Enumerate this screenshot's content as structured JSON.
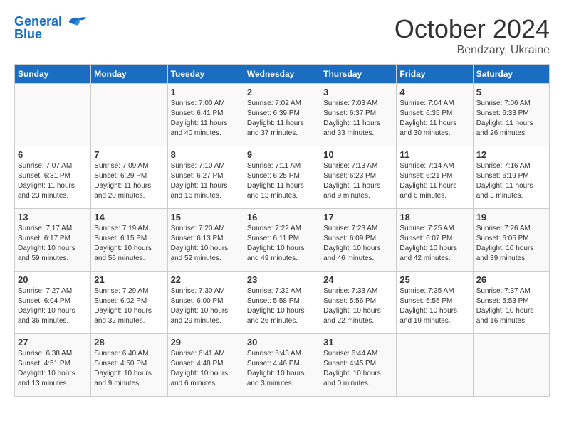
{
  "header": {
    "logo_line1": "General",
    "logo_line2": "Blue",
    "month": "October 2024",
    "location": "Bendzary, Ukraine"
  },
  "weekdays": [
    "Sunday",
    "Monday",
    "Tuesday",
    "Wednesday",
    "Thursday",
    "Friday",
    "Saturday"
  ],
  "weeks": [
    [
      {
        "day": "",
        "info": ""
      },
      {
        "day": "",
        "info": ""
      },
      {
        "day": "1",
        "info": "Sunrise: 7:00 AM\nSunset: 6:41 PM\nDaylight: 11 hours\nand 40 minutes."
      },
      {
        "day": "2",
        "info": "Sunrise: 7:02 AM\nSunset: 6:39 PM\nDaylight: 11 hours\nand 37 minutes."
      },
      {
        "day": "3",
        "info": "Sunrise: 7:03 AM\nSunset: 6:37 PM\nDaylight: 11 hours\nand 33 minutes."
      },
      {
        "day": "4",
        "info": "Sunrise: 7:04 AM\nSunset: 6:35 PM\nDaylight: 11 hours\nand 30 minutes."
      },
      {
        "day": "5",
        "info": "Sunrise: 7:06 AM\nSunset: 6:33 PM\nDaylight: 11 hours\nand 26 minutes."
      }
    ],
    [
      {
        "day": "6",
        "info": "Sunrise: 7:07 AM\nSunset: 6:31 PM\nDaylight: 11 hours\nand 23 minutes."
      },
      {
        "day": "7",
        "info": "Sunrise: 7:09 AM\nSunset: 6:29 PM\nDaylight: 11 hours\nand 20 minutes."
      },
      {
        "day": "8",
        "info": "Sunrise: 7:10 AM\nSunset: 6:27 PM\nDaylight: 11 hours\nand 16 minutes."
      },
      {
        "day": "9",
        "info": "Sunrise: 7:11 AM\nSunset: 6:25 PM\nDaylight: 11 hours\nand 13 minutes."
      },
      {
        "day": "10",
        "info": "Sunrise: 7:13 AM\nSunset: 6:23 PM\nDaylight: 11 hours\nand 9 minutes."
      },
      {
        "day": "11",
        "info": "Sunrise: 7:14 AM\nSunset: 6:21 PM\nDaylight: 11 hours\nand 6 minutes."
      },
      {
        "day": "12",
        "info": "Sunrise: 7:16 AM\nSunset: 6:19 PM\nDaylight: 11 hours\nand 3 minutes."
      }
    ],
    [
      {
        "day": "13",
        "info": "Sunrise: 7:17 AM\nSunset: 6:17 PM\nDaylight: 10 hours\nand 59 minutes."
      },
      {
        "day": "14",
        "info": "Sunrise: 7:19 AM\nSunset: 6:15 PM\nDaylight: 10 hours\nand 56 minutes."
      },
      {
        "day": "15",
        "info": "Sunrise: 7:20 AM\nSunset: 6:13 PM\nDaylight: 10 hours\nand 52 minutes."
      },
      {
        "day": "16",
        "info": "Sunrise: 7:22 AM\nSunset: 6:11 PM\nDaylight: 10 hours\nand 49 minutes."
      },
      {
        "day": "17",
        "info": "Sunrise: 7:23 AM\nSunset: 6:09 PM\nDaylight: 10 hours\nand 46 minutes."
      },
      {
        "day": "18",
        "info": "Sunrise: 7:25 AM\nSunset: 6:07 PM\nDaylight: 10 hours\nand 42 minutes."
      },
      {
        "day": "19",
        "info": "Sunrise: 7:26 AM\nSunset: 6:05 PM\nDaylight: 10 hours\nand 39 minutes."
      }
    ],
    [
      {
        "day": "20",
        "info": "Sunrise: 7:27 AM\nSunset: 6:04 PM\nDaylight: 10 hours\nand 36 minutes."
      },
      {
        "day": "21",
        "info": "Sunrise: 7:29 AM\nSunset: 6:02 PM\nDaylight: 10 hours\nand 32 minutes."
      },
      {
        "day": "22",
        "info": "Sunrise: 7:30 AM\nSunset: 6:00 PM\nDaylight: 10 hours\nand 29 minutes."
      },
      {
        "day": "23",
        "info": "Sunrise: 7:32 AM\nSunset: 5:58 PM\nDaylight: 10 hours\nand 26 minutes."
      },
      {
        "day": "24",
        "info": "Sunrise: 7:33 AM\nSunset: 5:56 PM\nDaylight: 10 hours\nand 22 minutes."
      },
      {
        "day": "25",
        "info": "Sunrise: 7:35 AM\nSunset: 5:55 PM\nDaylight: 10 hours\nand 19 minutes."
      },
      {
        "day": "26",
        "info": "Sunrise: 7:37 AM\nSunset: 5:53 PM\nDaylight: 10 hours\nand 16 minutes."
      }
    ],
    [
      {
        "day": "27",
        "info": "Sunrise: 6:38 AM\nSunset: 4:51 PM\nDaylight: 10 hours\nand 13 minutes."
      },
      {
        "day": "28",
        "info": "Sunrise: 6:40 AM\nSunset: 4:50 PM\nDaylight: 10 hours\nand 9 minutes."
      },
      {
        "day": "29",
        "info": "Sunrise: 6:41 AM\nSunset: 4:48 PM\nDaylight: 10 hours\nand 6 minutes."
      },
      {
        "day": "30",
        "info": "Sunrise: 6:43 AM\nSunset: 4:46 PM\nDaylight: 10 hours\nand 3 minutes."
      },
      {
        "day": "31",
        "info": "Sunrise: 6:44 AM\nSunset: 4:45 PM\nDaylight: 10 hours\nand 0 minutes."
      },
      {
        "day": "",
        "info": ""
      },
      {
        "day": "",
        "info": ""
      }
    ]
  ]
}
